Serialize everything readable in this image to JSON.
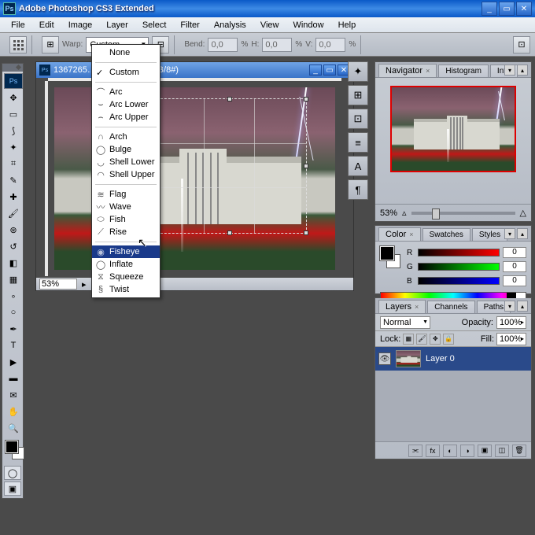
{
  "app": {
    "title": "Adobe Photoshop CS3 Extended",
    "logo": "Ps"
  },
  "menu": [
    "File",
    "Edit",
    "Image",
    "Layer",
    "Select",
    "Filter",
    "Analysis",
    "View",
    "Window",
    "Help"
  ],
  "options": {
    "warp_label": "Warp:",
    "warp_value": "Custom",
    "bend_label": "Bend:",
    "bend_value": "0,0",
    "pct": "%",
    "h_label": "H:",
    "h_value": "0,0",
    "v_label": "V:",
    "v_value": "0,0"
  },
  "warp_menu": {
    "none": "None",
    "custom": "Custom",
    "group1": [
      "Arc",
      "Arc Lower",
      "Arc Upper"
    ],
    "group2": [
      "Arch",
      "Bulge",
      "Shell Lower",
      "Shell Upper"
    ],
    "group3": [
      "Flag",
      "Wave",
      "Fish",
      "Rise"
    ],
    "group4": [
      "Fisheye",
      "Inflate",
      "Squeeze",
      "Twist"
    ]
  },
  "doc": {
    "title": "1367265… % (Layer 0, RGB/8#)",
    "zoom": "53%"
  },
  "navigator": {
    "tabs": [
      "Navigator",
      "Histogram",
      "Info"
    ],
    "zoom": "53%"
  },
  "color": {
    "tabs": [
      "Color",
      "Swatches",
      "Styles"
    ],
    "channels": [
      {
        "l": "R",
        "v": "0"
      },
      {
        "l": "G",
        "v": "0"
      },
      {
        "l": "B",
        "v": "0"
      }
    ]
  },
  "layers": {
    "tabs": [
      "Layers",
      "Channels",
      "Paths"
    ],
    "blend": "Normal",
    "opacity_l": "Opacity:",
    "opacity": "100%",
    "lock_l": "Lock:",
    "fill_l": "Fill:",
    "fill": "100%",
    "layer0": "Layer 0"
  }
}
